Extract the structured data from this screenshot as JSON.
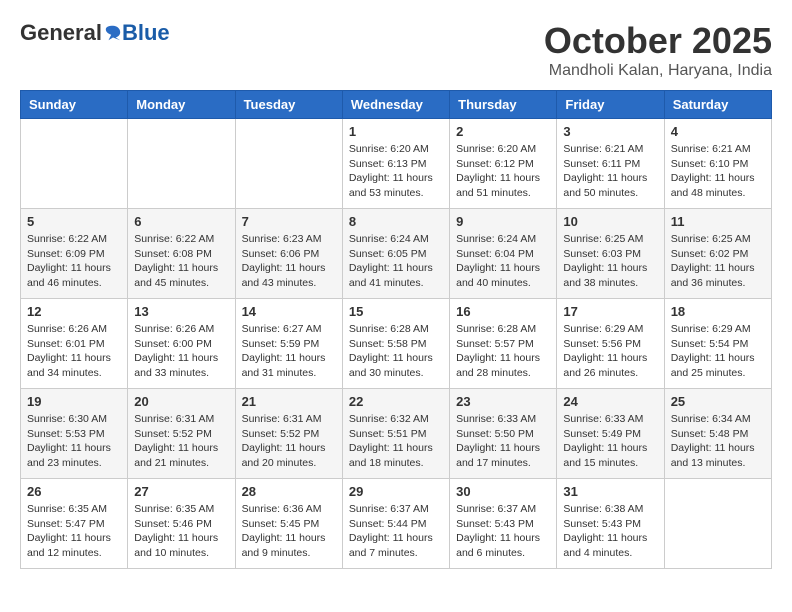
{
  "header": {
    "logo_general": "General",
    "logo_blue": "Blue",
    "month_title": "October 2025",
    "location": "Mandholi Kalan, Haryana, India"
  },
  "days_of_week": [
    "Sunday",
    "Monday",
    "Tuesday",
    "Wednesday",
    "Thursday",
    "Friday",
    "Saturday"
  ],
  "weeks": [
    [
      {
        "day": "",
        "info": ""
      },
      {
        "day": "",
        "info": ""
      },
      {
        "day": "",
        "info": ""
      },
      {
        "day": "1",
        "sunrise": "Sunrise: 6:20 AM",
        "sunset": "Sunset: 6:13 PM",
        "daylight": "Daylight: 11 hours and 53 minutes."
      },
      {
        "day": "2",
        "sunrise": "Sunrise: 6:20 AM",
        "sunset": "Sunset: 6:12 PM",
        "daylight": "Daylight: 11 hours and 51 minutes."
      },
      {
        "day": "3",
        "sunrise": "Sunrise: 6:21 AM",
        "sunset": "Sunset: 6:11 PM",
        "daylight": "Daylight: 11 hours and 50 minutes."
      },
      {
        "day": "4",
        "sunrise": "Sunrise: 6:21 AM",
        "sunset": "Sunset: 6:10 PM",
        "daylight": "Daylight: 11 hours and 48 minutes."
      }
    ],
    [
      {
        "day": "5",
        "sunrise": "Sunrise: 6:22 AM",
        "sunset": "Sunset: 6:09 PM",
        "daylight": "Daylight: 11 hours and 46 minutes."
      },
      {
        "day": "6",
        "sunrise": "Sunrise: 6:22 AM",
        "sunset": "Sunset: 6:08 PM",
        "daylight": "Daylight: 11 hours and 45 minutes."
      },
      {
        "day": "7",
        "sunrise": "Sunrise: 6:23 AM",
        "sunset": "Sunset: 6:06 PM",
        "daylight": "Daylight: 11 hours and 43 minutes."
      },
      {
        "day": "8",
        "sunrise": "Sunrise: 6:24 AM",
        "sunset": "Sunset: 6:05 PM",
        "daylight": "Daylight: 11 hours and 41 minutes."
      },
      {
        "day": "9",
        "sunrise": "Sunrise: 6:24 AM",
        "sunset": "Sunset: 6:04 PM",
        "daylight": "Daylight: 11 hours and 40 minutes."
      },
      {
        "day": "10",
        "sunrise": "Sunrise: 6:25 AM",
        "sunset": "Sunset: 6:03 PM",
        "daylight": "Daylight: 11 hours and 38 minutes."
      },
      {
        "day": "11",
        "sunrise": "Sunrise: 6:25 AM",
        "sunset": "Sunset: 6:02 PM",
        "daylight": "Daylight: 11 hours and 36 minutes."
      }
    ],
    [
      {
        "day": "12",
        "sunrise": "Sunrise: 6:26 AM",
        "sunset": "Sunset: 6:01 PM",
        "daylight": "Daylight: 11 hours and 34 minutes."
      },
      {
        "day": "13",
        "sunrise": "Sunrise: 6:26 AM",
        "sunset": "Sunset: 6:00 PM",
        "daylight": "Daylight: 11 hours and 33 minutes."
      },
      {
        "day": "14",
        "sunrise": "Sunrise: 6:27 AM",
        "sunset": "Sunset: 5:59 PM",
        "daylight": "Daylight: 11 hours and 31 minutes."
      },
      {
        "day": "15",
        "sunrise": "Sunrise: 6:28 AM",
        "sunset": "Sunset: 5:58 PM",
        "daylight": "Daylight: 11 hours and 30 minutes."
      },
      {
        "day": "16",
        "sunrise": "Sunrise: 6:28 AM",
        "sunset": "Sunset: 5:57 PM",
        "daylight": "Daylight: 11 hours and 28 minutes."
      },
      {
        "day": "17",
        "sunrise": "Sunrise: 6:29 AM",
        "sunset": "Sunset: 5:56 PM",
        "daylight": "Daylight: 11 hours and 26 minutes."
      },
      {
        "day": "18",
        "sunrise": "Sunrise: 6:29 AM",
        "sunset": "Sunset: 5:54 PM",
        "daylight": "Daylight: 11 hours and 25 minutes."
      }
    ],
    [
      {
        "day": "19",
        "sunrise": "Sunrise: 6:30 AM",
        "sunset": "Sunset: 5:53 PM",
        "daylight": "Daylight: 11 hours and 23 minutes."
      },
      {
        "day": "20",
        "sunrise": "Sunrise: 6:31 AM",
        "sunset": "Sunset: 5:52 PM",
        "daylight": "Daylight: 11 hours and 21 minutes."
      },
      {
        "day": "21",
        "sunrise": "Sunrise: 6:31 AM",
        "sunset": "Sunset: 5:52 PM",
        "daylight": "Daylight: 11 hours and 20 minutes."
      },
      {
        "day": "22",
        "sunrise": "Sunrise: 6:32 AM",
        "sunset": "Sunset: 5:51 PM",
        "daylight": "Daylight: 11 hours and 18 minutes."
      },
      {
        "day": "23",
        "sunrise": "Sunrise: 6:33 AM",
        "sunset": "Sunset: 5:50 PM",
        "daylight": "Daylight: 11 hours and 17 minutes."
      },
      {
        "day": "24",
        "sunrise": "Sunrise: 6:33 AM",
        "sunset": "Sunset: 5:49 PM",
        "daylight": "Daylight: 11 hours and 15 minutes."
      },
      {
        "day": "25",
        "sunrise": "Sunrise: 6:34 AM",
        "sunset": "Sunset: 5:48 PM",
        "daylight": "Daylight: 11 hours and 13 minutes."
      }
    ],
    [
      {
        "day": "26",
        "sunrise": "Sunrise: 6:35 AM",
        "sunset": "Sunset: 5:47 PM",
        "daylight": "Daylight: 11 hours and 12 minutes."
      },
      {
        "day": "27",
        "sunrise": "Sunrise: 6:35 AM",
        "sunset": "Sunset: 5:46 PM",
        "daylight": "Daylight: 11 hours and 10 minutes."
      },
      {
        "day": "28",
        "sunrise": "Sunrise: 6:36 AM",
        "sunset": "Sunset: 5:45 PM",
        "daylight": "Daylight: 11 hours and 9 minutes."
      },
      {
        "day": "29",
        "sunrise": "Sunrise: 6:37 AM",
        "sunset": "Sunset: 5:44 PM",
        "daylight": "Daylight: 11 hours and 7 minutes."
      },
      {
        "day": "30",
        "sunrise": "Sunrise: 6:37 AM",
        "sunset": "Sunset: 5:43 PM",
        "daylight": "Daylight: 11 hours and 6 minutes."
      },
      {
        "day": "31",
        "sunrise": "Sunrise: 6:38 AM",
        "sunset": "Sunset: 5:43 PM",
        "daylight": "Daylight: 11 hours and 4 minutes."
      },
      {
        "day": "",
        "info": ""
      }
    ]
  ]
}
